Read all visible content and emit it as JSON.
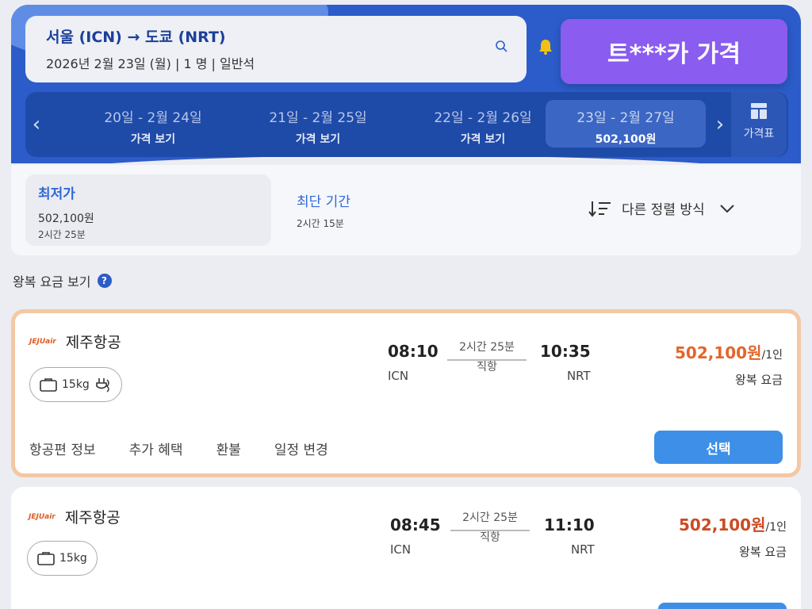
{
  "search": {
    "route": "서울 (ICN) → 도쿄 (NRT)",
    "details": "2026년 2월 23일 (월)  |  1 명  |  일반석"
  },
  "banner": "트***카 가격",
  "date_tabs": [
    {
      "dates": "20일 - 2월 24일",
      "price": "가격 보기"
    },
    {
      "dates": "21일 - 2월 25일",
      "price": "가격 보기"
    },
    {
      "dates": "22일 - 2월 26일",
      "price": "가격 보기"
    },
    {
      "dates": "23일 - 2월 27일",
      "price": "502,100원"
    }
  ],
  "price_table_label": "가격표",
  "sort": {
    "cheapest": {
      "title": "최저가",
      "price": "502,100원",
      "duration": "2시간 25분"
    },
    "shortest": {
      "title": "최단 기간",
      "duration": "2시간 15분"
    },
    "other": "다른 정렬 방식"
  },
  "roundtrip_label": "왕복 요금 보기",
  "flights": [
    {
      "airline": "제주항공",
      "logo_text": "JEJUair",
      "baggage": "15kg",
      "depart_time": "08:10",
      "depart_airport": "ICN",
      "duration": "2시간 25분",
      "stops": "직항",
      "arrive_time": "10:35",
      "arrive_airport": "NRT",
      "price": "502,100원",
      "price_unit": "/1인",
      "price_type": "왕복 요금",
      "links": [
        "항공편 정보",
        "추가 혜택",
        "환불",
        "일정 변경"
      ],
      "select_label": "선택"
    },
    {
      "airline": "제주항공",
      "logo_text": "JEJUair",
      "baggage": "15kg",
      "depart_time": "08:45",
      "depart_airport": "ICN",
      "duration": "2시간 25분",
      "stops": "직항",
      "arrive_time": "11:10",
      "arrive_airport": "NRT",
      "price": "502,100원",
      "price_unit": "/1인",
      "price_type": "왕복 요금"
    }
  ],
  "colors": {
    "primary_blue": "#2c5cc9",
    "price_orange": "#e3652a",
    "banner_purple": "#8a5cf0",
    "select_button": "#3d8fe8"
  }
}
